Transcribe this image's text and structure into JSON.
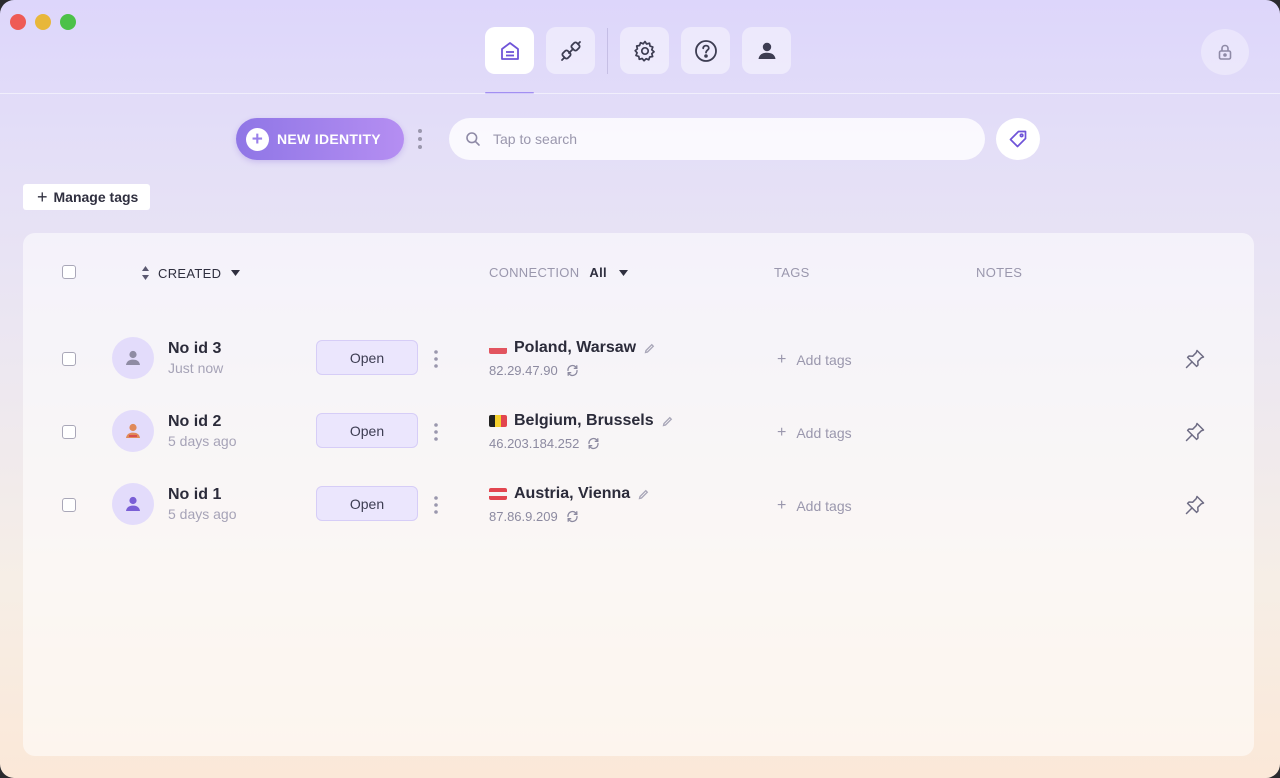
{
  "topnav": {
    "items": [
      {
        "icon": "identities-icon",
        "active": true
      },
      {
        "icon": "integrations-icon",
        "active": false
      },
      {
        "icon": "settings-icon",
        "active": false
      },
      {
        "icon": "help-icon",
        "active": false
      },
      {
        "icon": "account-icon",
        "active": false
      }
    ],
    "lock_icon": "lock-icon"
  },
  "toolbar": {
    "new_identity_label": "NEW IDENTITY",
    "search_placeholder": "Tap to search",
    "manage_tags_label": "Manage tags"
  },
  "table": {
    "headers": {
      "created": "CREATED",
      "connection": "CONNECTION",
      "connection_filter": "All",
      "tags": "TAGS",
      "notes": "NOTES"
    },
    "rows": [
      {
        "name": "No id 3",
        "time": "Just now",
        "open_label": "Open",
        "location": "Poland, Warsaw",
        "ip": "82.29.47.90",
        "flag": "poland",
        "add_tags": "Add tags"
      },
      {
        "name": "No id 2",
        "time": "5 days ago",
        "open_label": "Open",
        "location": "Belgium, Brussels",
        "ip": "46.203.184.252",
        "flag": "belgium",
        "add_tags": "Add tags"
      },
      {
        "name": "No id 1",
        "time": "5 days ago",
        "open_label": "Open",
        "location": "Austria, Vienna",
        "ip": "87.86.9.209",
        "flag": "austria",
        "add_tags": "Add tags"
      }
    ]
  },
  "colors": {
    "accent": "#9a80ea",
    "open_button_bg": "#ebe6fd"
  }
}
